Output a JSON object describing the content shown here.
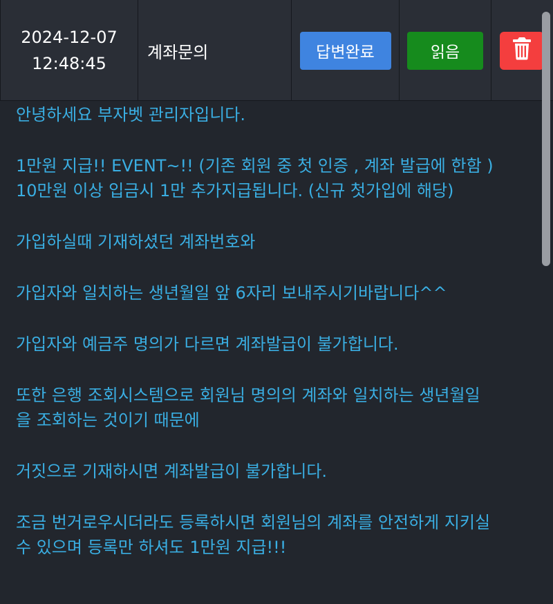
{
  "header": {
    "date": "2024-12-07",
    "time": "12:48:45",
    "title": "계좌문의",
    "status_button": "답변완료",
    "read_button": "읽음",
    "delete_icon": "trash-icon"
  },
  "message": {
    "lines": [
      "안녕하세요 부자벳 관리자입니다.",
      "",
      "1만원 지급!! EVENT~!! (기존 회원 중 첫 인증 , 계좌 발급에 한함 )",
      "10만원 이상 입금시 1만 추가지급됩니다. (신규 첫가입에 해당)",
      "",
      "가입하실때 기재하셨던 계좌번호와",
      "",
      "가입자와 일치하는 생년월일 앞 6자리 보내주시기바랍니다^^",
      "",
      "가입자와 예금주 명의가 다르면 계좌발급이 불가합니다.",
      "",
      "또한 은행 조회시스템으로 회원님 명의의 계좌와 일치하는 생년월일",
      "을 조회하는 것이기 때문에",
      "",
      "거짓으로 기재하시면 계좌발급이 불가합니다.",
      "",
      "조금 번거로우시더라도 등록하시면 회원님의 계좌를 안전하게 지키실",
      "수 있으며 등록만 하셔도 1만원 지급!!!"
    ]
  },
  "colors": {
    "background": "#22262d",
    "header_background": "#2a2e36",
    "message_text": "#3aaee2",
    "status_button": "#3f84e0",
    "read_button": "#168b1d",
    "delete_button": "#f43e3e"
  }
}
